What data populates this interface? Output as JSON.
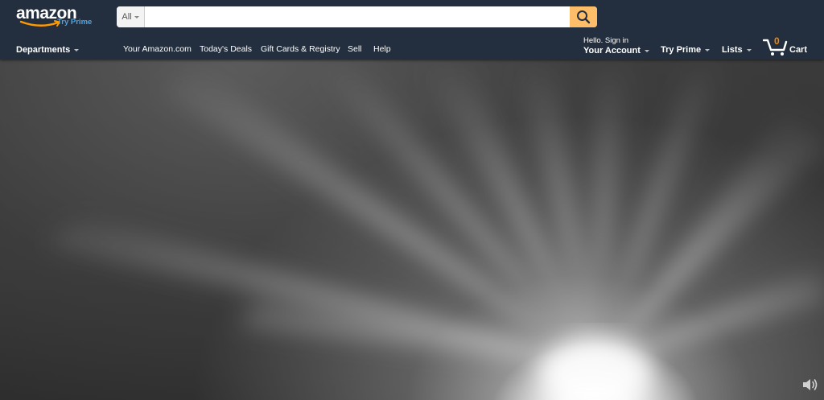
{
  "header": {
    "logo": {
      "word": "amazon",
      "prime": "Try Prime"
    },
    "search": {
      "scope": "All",
      "value": "",
      "placeholder": ""
    },
    "nav_links": {
      "departments": "Departments",
      "your_amazon": "Your Amazon.com",
      "todays_deals": "Today's Deals",
      "gift_cards": "Gift Cards & Registry",
      "sell": "Sell",
      "help": "Help"
    },
    "account": {
      "hello": "Hello. Sign in",
      "label": "Your Account"
    },
    "try_prime": "Try Prime",
    "lists": "Lists",
    "cart": {
      "count": "0",
      "label": "Cart"
    }
  },
  "icons": {
    "search": "search-icon",
    "cart": "cart-icon",
    "volume": "volume-icon"
  },
  "colors": {
    "nav_bg": "#232f3e",
    "search_button": "#febd69",
    "cart_count": "#f08804",
    "prime_blue": "#4ba6e5"
  }
}
